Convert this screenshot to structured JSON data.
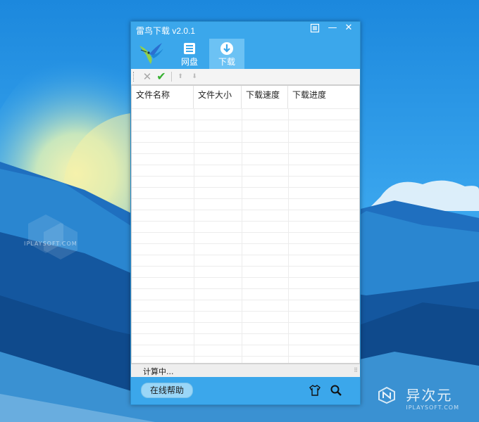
{
  "background": {
    "watermark": "IPLAYSOFT.COM",
    "brand_cn": "异次元",
    "brand_en": "IPLAYSOFT.COM",
    "brand_logo_icon": "hex-logo-icon"
  },
  "window": {
    "title": "雷鸟下载  v2.0.1",
    "controls": {
      "skin_icon": "skin-icon",
      "minimize_label": "—",
      "close_label": "✕"
    },
    "tabs": [
      {
        "label": "网盘",
        "icon": "netdisk-icon",
        "active": false
      },
      {
        "label": "下载",
        "icon": "download-icon",
        "active": true
      }
    ],
    "actions": {
      "delete_label": "✕",
      "confirm_label": "✔",
      "up_label": "⬆",
      "down_label": "⬇"
    },
    "table": {
      "columns": [
        "文件名称",
        "文件大小",
        "下载速度",
        "下载进度"
      ],
      "rows": []
    },
    "status": {
      "text": "计算中...",
      "resize_grip": "⠿"
    },
    "footer": {
      "help_label": "在线帮助",
      "shirt_icon": "tshirt-icon",
      "search_icon": "search-icon"
    }
  },
  "colors": {
    "window_blue": "#3ba7eb",
    "active_tab": "#6cc2f4",
    "confirm_green": "#36b030"
  }
}
